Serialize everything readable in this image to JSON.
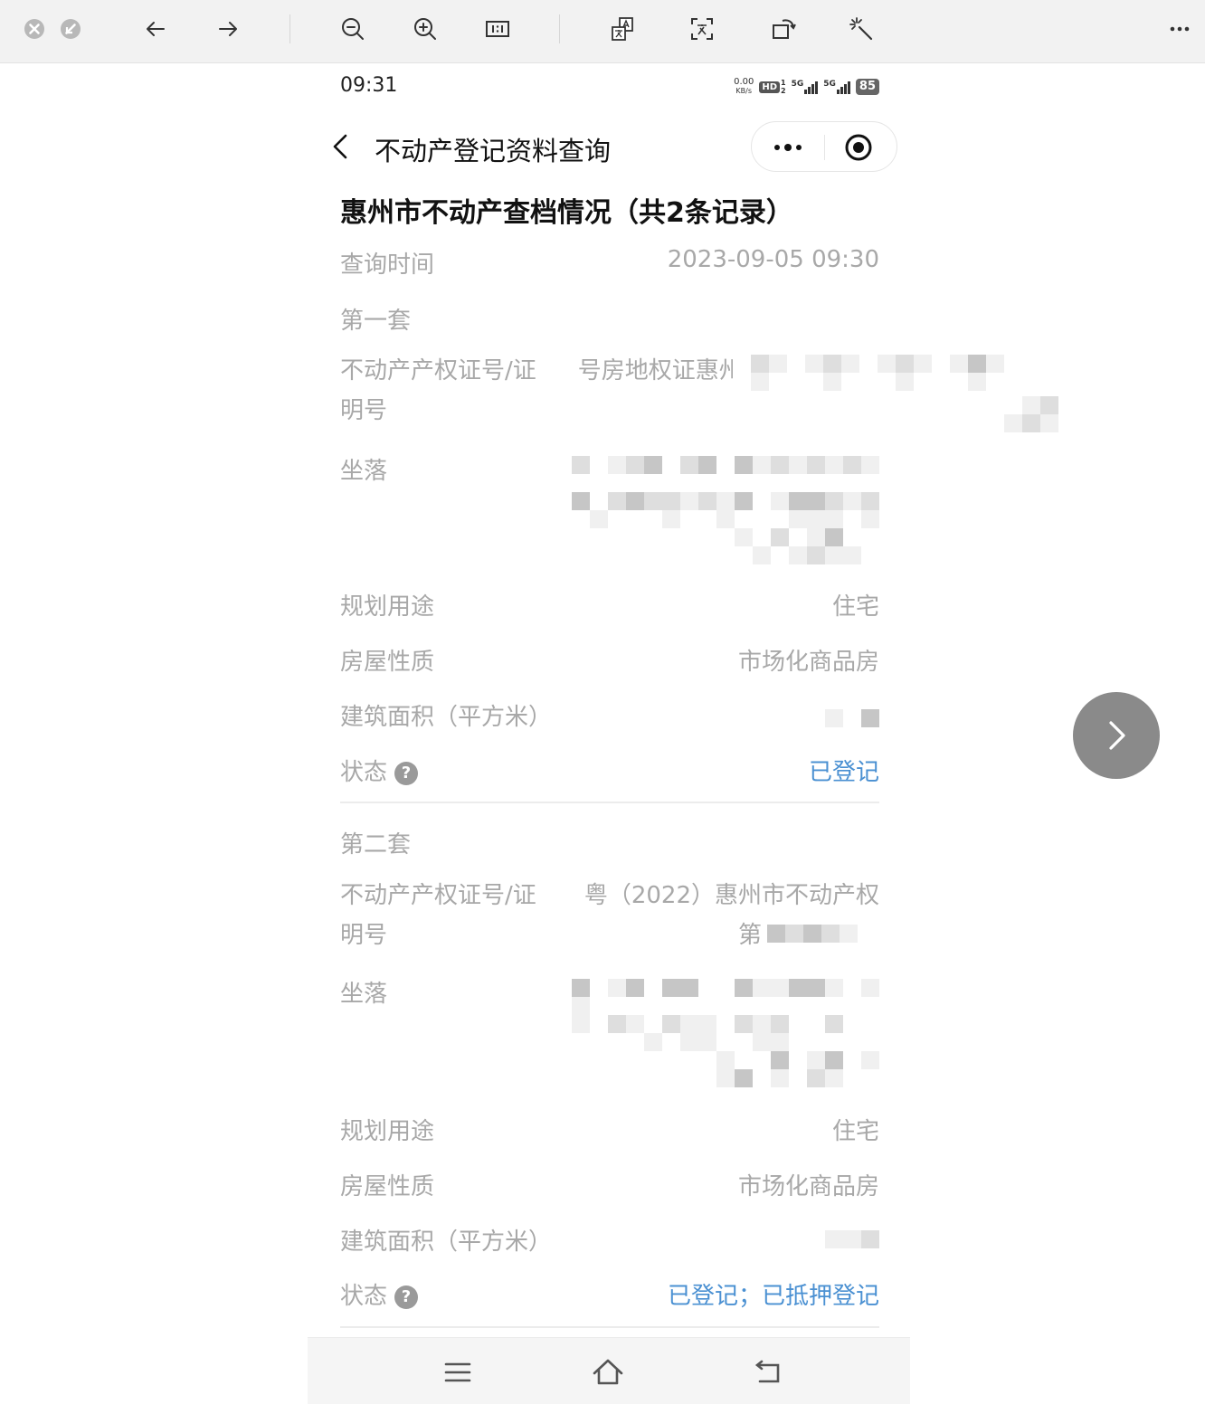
{
  "phone": {
    "status": {
      "time": "09:31",
      "speed_value": "0.00",
      "speed_unit": "KB/s",
      "hd_badge": "HD",
      "sim1": "1",
      "sim2": "2",
      "net1": "5G",
      "net2": "5G",
      "battery": "85"
    },
    "nav": {
      "title": "不动产登记资料查询"
    },
    "section_title": "惠州市不动产查档情况（共2条记录）",
    "query_time": {
      "label": "查询时间",
      "value": "2023-09-05 09:30"
    },
    "records": [
      {
        "heading": "第一套",
        "cert_label": "不动产产权证号/证明号",
        "cert_value_line1": "号房地权证惠州市第110022",
        "cert_value_line2": "7353号",
        "location_label": "坐落",
        "usage_label": "规划用途",
        "usage_value": "住宅",
        "nature_label": "房屋性质",
        "nature_value": "市场化商品房",
        "area_label": "建筑面积（平方米）",
        "status_label": "状态",
        "status_value": "已登记"
      },
      {
        "heading": "第二套",
        "cert_label": "不动产产权证号/证明号",
        "cert_value_line1": "粤（2022）惠州市不动产权",
        "cert_value_line2": "第",
        "location_label": "坐落",
        "usage_label": "规划用途",
        "usage_value": "住宅",
        "nature_label": "房屋性质",
        "nature_value": "市场化商品房",
        "area_label": "建筑面积（平方米）",
        "status_label": "状态",
        "status_value": "已登记；已抵押登记"
      }
    ],
    "help_glyph": "?"
  },
  "colors": {
    "toolbar_bg": "#f2f2f2",
    "label_gray": "#a8a8a8",
    "link_blue": "#4a90d2",
    "next_button": "#8a8a8a"
  }
}
